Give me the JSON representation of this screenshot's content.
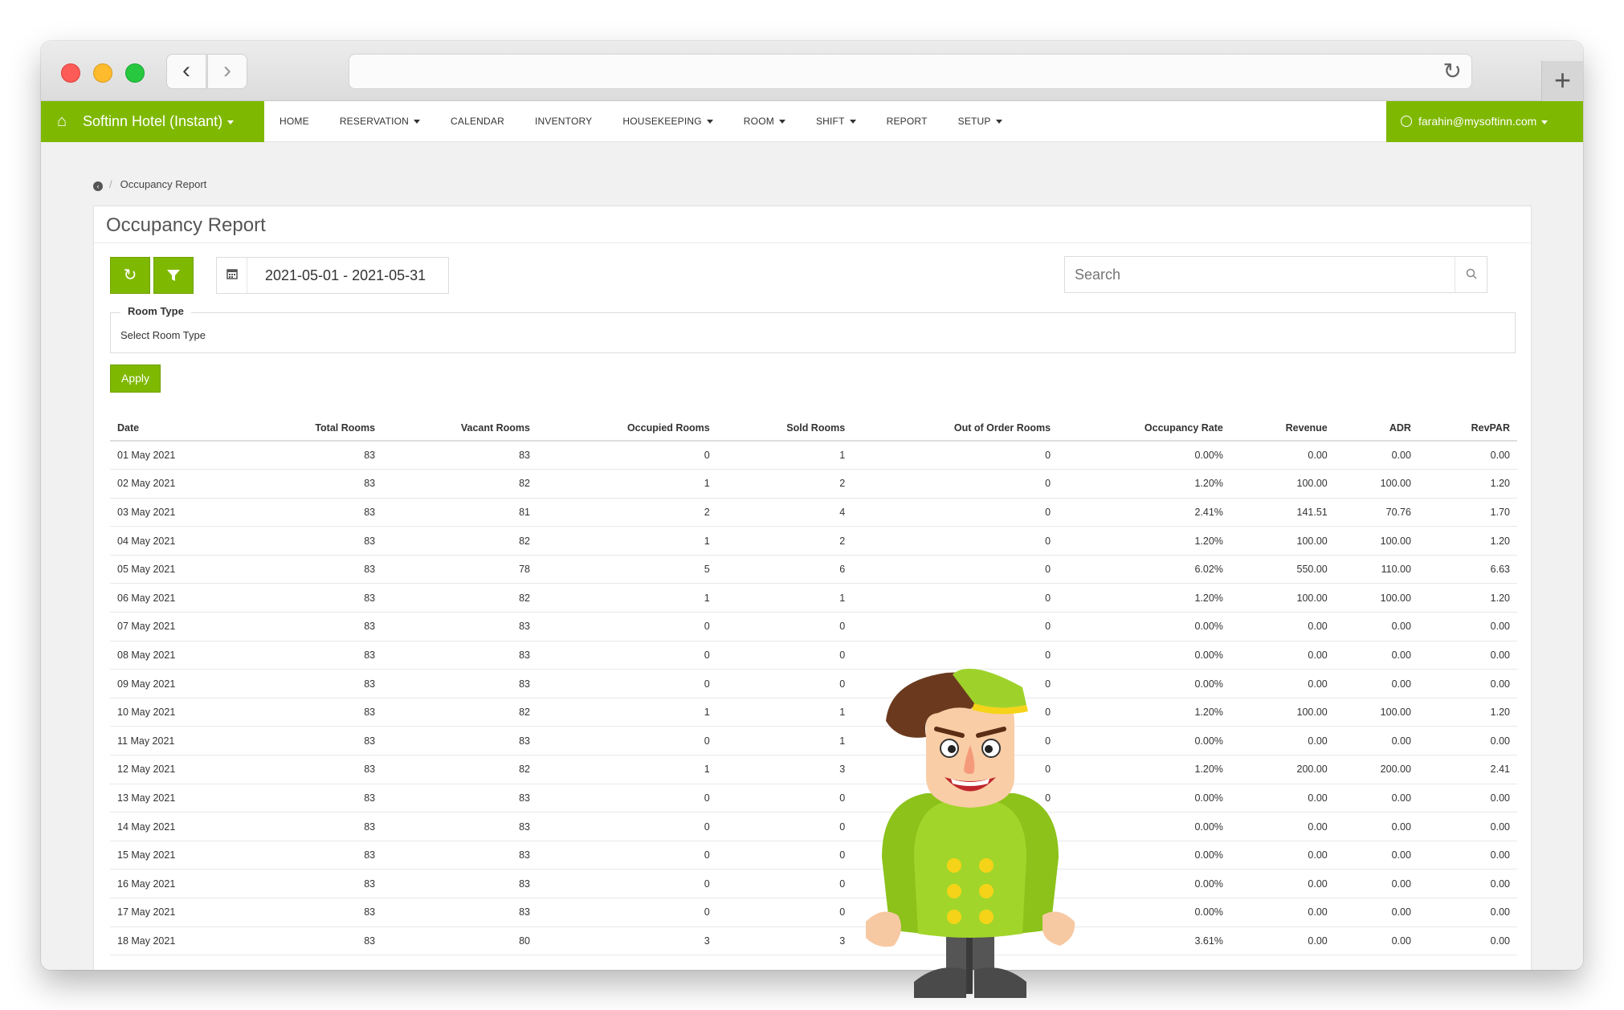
{
  "browser": {
    "back_icon": "chevron-left-icon",
    "forward_icon": "chevron-right-icon",
    "reload_icon": "reload-icon",
    "new_tab_icon": "plus-icon"
  },
  "nav": {
    "brand": "Softinn Hotel (Instant)",
    "brand_color": "#7fb800",
    "items": [
      {
        "label": "HOME",
        "dropdown": false
      },
      {
        "label": "RESERVATION",
        "dropdown": true
      },
      {
        "label": "CALENDAR",
        "dropdown": false
      },
      {
        "label": "INVENTORY",
        "dropdown": false
      },
      {
        "label": "HOUSEKEEPING",
        "dropdown": true
      },
      {
        "label": "ROOM",
        "dropdown": true
      },
      {
        "label": "SHIFT",
        "dropdown": true
      },
      {
        "label": "REPORT",
        "dropdown": false
      },
      {
        "label": "SETUP",
        "dropdown": true
      }
    ],
    "user": "farahin@mysoftinn.com"
  },
  "breadcrumb": {
    "current": "Occupancy Report"
  },
  "page": {
    "title": "Occupancy Report",
    "date_range": "2021-05-01 - 2021-05-31",
    "search_placeholder": "Search",
    "room_type_label": "Room Type",
    "room_type_value": "Select Room Type",
    "apply_label": "Apply"
  },
  "table": {
    "columns": [
      "Date",
      "Total Rooms",
      "Vacant Rooms",
      "Occupied Rooms",
      "Sold Rooms",
      "Out of Order Rooms",
      "Occupancy Rate",
      "Revenue",
      "ADR",
      "RevPAR"
    ],
    "rows": [
      [
        "01 May 2021",
        "83",
        "83",
        "0",
        "1",
        "0",
        "0.00%",
        "0.00",
        "0.00",
        "0.00"
      ],
      [
        "02 May 2021",
        "83",
        "82",
        "1",
        "2",
        "0",
        "1.20%",
        "100.00",
        "100.00",
        "1.20"
      ],
      [
        "03 May 2021",
        "83",
        "81",
        "2",
        "4",
        "0",
        "2.41%",
        "141.51",
        "70.76",
        "1.70"
      ],
      [
        "04 May 2021",
        "83",
        "82",
        "1",
        "2",
        "0",
        "1.20%",
        "100.00",
        "100.00",
        "1.20"
      ],
      [
        "05 May 2021",
        "83",
        "78",
        "5",
        "6",
        "0",
        "6.02%",
        "550.00",
        "110.00",
        "6.63"
      ],
      [
        "06 May 2021",
        "83",
        "82",
        "1",
        "1",
        "0",
        "1.20%",
        "100.00",
        "100.00",
        "1.20"
      ],
      [
        "07 May 2021",
        "83",
        "83",
        "0",
        "0",
        "0",
        "0.00%",
        "0.00",
        "0.00",
        "0.00"
      ],
      [
        "08 May 2021",
        "83",
        "83",
        "0",
        "0",
        "0",
        "0.00%",
        "0.00",
        "0.00",
        "0.00"
      ],
      [
        "09 May 2021",
        "83",
        "83",
        "0",
        "0",
        "0",
        "0.00%",
        "0.00",
        "0.00",
        "0.00"
      ],
      [
        "10 May 2021",
        "83",
        "82",
        "1",
        "1",
        "0",
        "1.20%",
        "100.00",
        "100.00",
        "1.20"
      ],
      [
        "11 May 2021",
        "83",
        "83",
        "0",
        "1",
        "0",
        "0.00%",
        "0.00",
        "0.00",
        "0.00"
      ],
      [
        "12 May 2021",
        "83",
        "82",
        "1",
        "3",
        "0",
        "1.20%",
        "200.00",
        "200.00",
        "2.41"
      ],
      [
        "13 May 2021",
        "83",
        "83",
        "0",
        "0",
        "0",
        "0.00%",
        "0.00",
        "0.00",
        "0.00"
      ],
      [
        "14 May 2021",
        "83",
        "83",
        "0",
        "0",
        "0",
        "0.00%",
        "0.00",
        "0.00",
        "0.00"
      ],
      [
        "15 May 2021",
        "83",
        "83",
        "0",
        "0",
        "",
        "0.00%",
        "0.00",
        "0.00",
        "0.00"
      ],
      [
        "16 May 2021",
        "83",
        "83",
        "0",
        "0",
        "",
        "0.00%",
        "0.00",
        "0.00",
        "0.00"
      ],
      [
        "17 May 2021",
        "83",
        "83",
        "0",
        "0",
        "",
        "0.00%",
        "0.00",
        "0.00",
        "0.00"
      ],
      [
        "18 May 2021",
        "83",
        "80",
        "3",
        "3",
        "",
        "3.61%",
        "0.00",
        "0.00",
        "0.00"
      ]
    ]
  }
}
